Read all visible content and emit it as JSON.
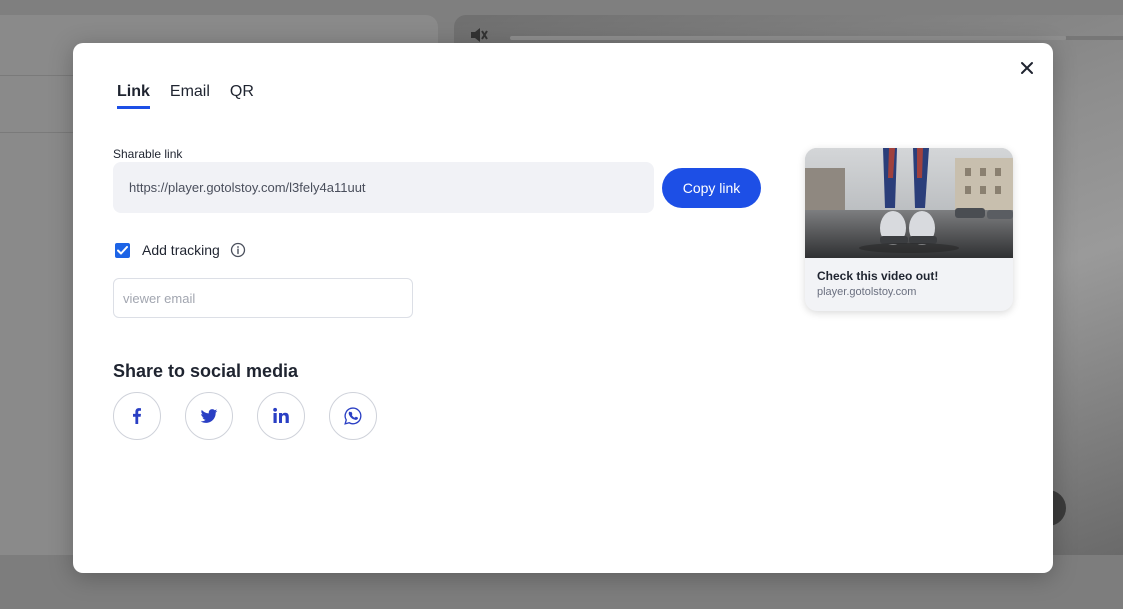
{
  "modal": {
    "tabs": [
      {
        "label": "Link",
        "active": true
      },
      {
        "label": "Email",
        "active": false
      },
      {
        "label": "QR",
        "active": false
      }
    ],
    "sharable_label": "Sharable link",
    "link_value": "https://player.gotolstoy.com/l3fely4a11uut",
    "copy_button": "Copy link",
    "tracking": {
      "label": "Add tracking",
      "checked": true
    },
    "email_placeholder": "viewer email",
    "social_title": "Share to social media",
    "social_icons": [
      "facebook-icon",
      "twitter-icon",
      "linkedin-icon",
      "whatsapp-icon"
    ],
    "preview": {
      "title": "Check this video out!",
      "domain": "player.gotolstoy.com"
    }
  },
  "colors": {
    "accent": "#1d4fe6",
    "social_icon": "#2a3fc4",
    "overlay": "#7f7f7f"
  }
}
